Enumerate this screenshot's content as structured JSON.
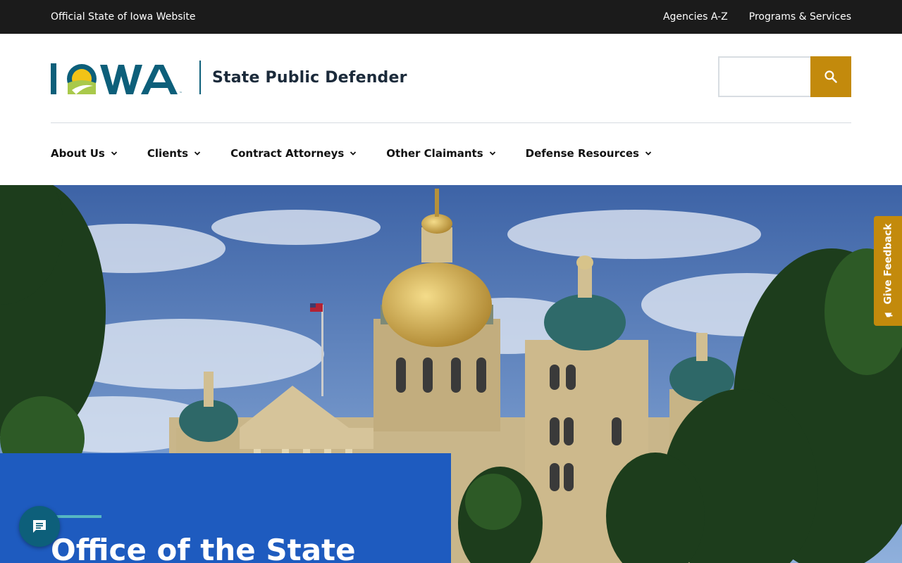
{
  "utility_bar": {
    "official_text": "Official State of Iowa Website",
    "links": [
      "Agencies A-Z",
      "Programs & Services"
    ]
  },
  "header": {
    "logo_text": "IOWA",
    "site_name": "State Public Defender",
    "search": {
      "placeholder": "",
      "button_icon": "search-icon"
    }
  },
  "nav": {
    "items": [
      "About Us",
      "Clients",
      "Contract Attorneys",
      "Other Claimants",
      "Defense Resources"
    ]
  },
  "hero": {
    "title": "Office of the State",
    "feedback_label": "Give Feedback",
    "chat_icon": "chat-icon"
  },
  "colors": {
    "utility_bar_bg": "#1b1b1b",
    "brand_teal": "#0d5f7a",
    "accent_gold": "#c38a0c",
    "hero_card_blue": "#1e5bbf",
    "accent_line": "#56b7c2"
  }
}
